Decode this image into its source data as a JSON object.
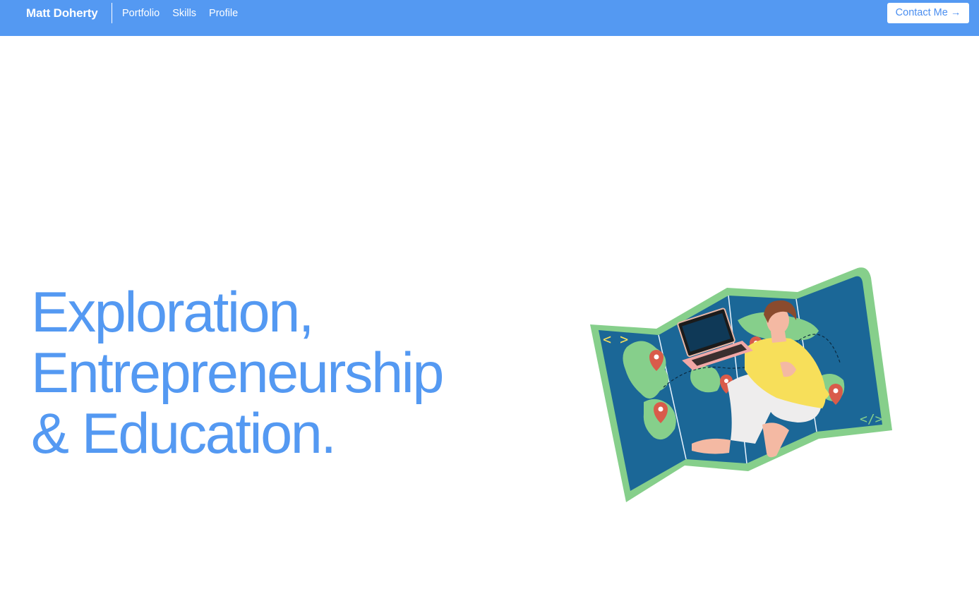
{
  "nav": {
    "brand": "Matt Doherty",
    "links": [
      "Portfolio",
      "Skills",
      "Profile"
    ],
    "contact_label": "Contact Me →"
  },
  "hero": {
    "lines": [
      "Exploration,",
      "Entrepreneurship",
      "& Education."
    ]
  },
  "illustration": {
    "icon": "world-map-traveler-laptop-illustration"
  },
  "colors": {
    "accent": "#5499f2",
    "nav_bg": "#5499f2",
    "map_ocean": "#1b6797",
    "map_land": "#86cf8b",
    "shirt": "#f7df5a",
    "pin": "#d95b4a"
  }
}
